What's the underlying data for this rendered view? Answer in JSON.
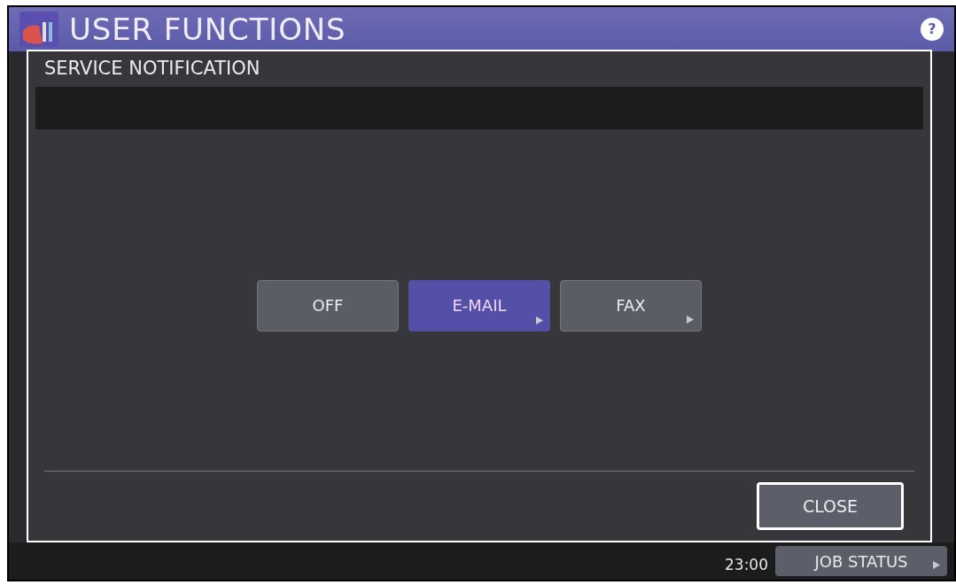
{
  "header": {
    "title": "USER FUNCTIONS",
    "help": "?"
  },
  "dialog": {
    "title": "SERVICE NOTIFICATION",
    "options": [
      {
        "label": "OFF",
        "selected": false,
        "submenu": false
      },
      {
        "label": "E-MAIL",
        "selected": true,
        "submenu": true
      },
      {
        "label": "FAX",
        "selected": false,
        "submenu": true
      }
    ],
    "close": "CLOSE"
  },
  "status_bar": {
    "time": "23:00",
    "job_status": "JOB STATUS"
  }
}
